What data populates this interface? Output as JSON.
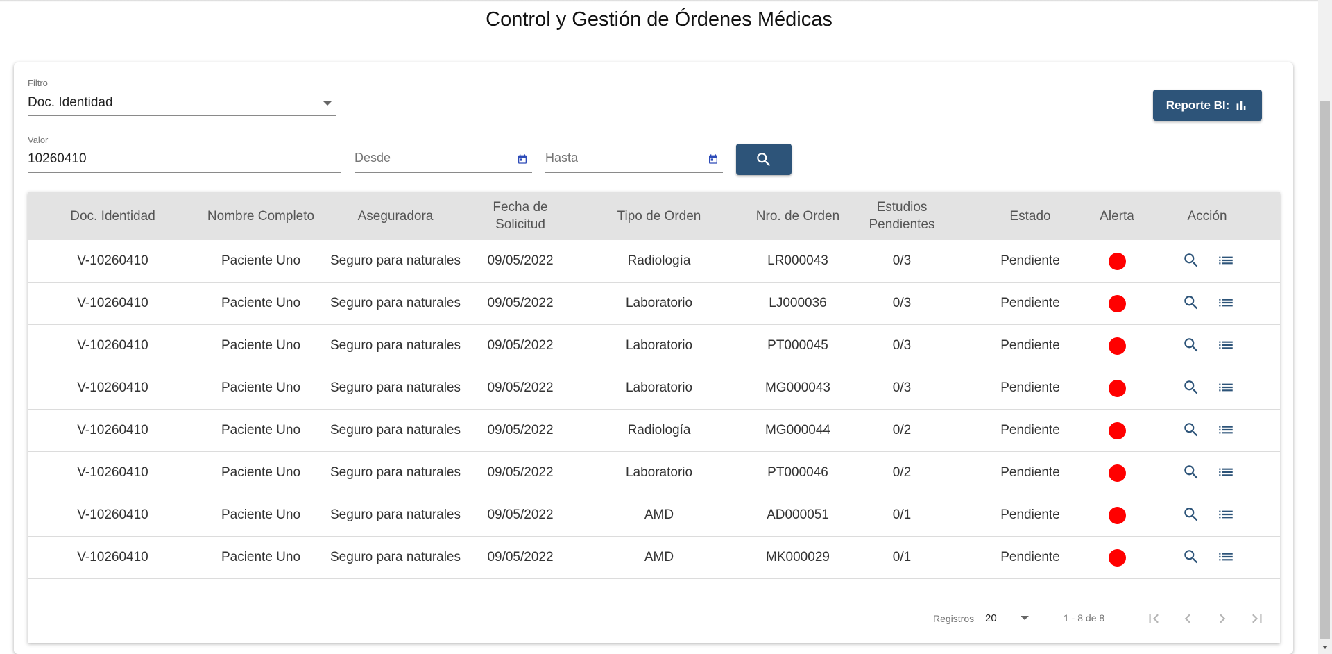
{
  "page": {
    "title": "Control y Gestión de Órdenes Médicas"
  },
  "filters": {
    "filter_label": "Filtro",
    "filter_value": "Doc. Identidad",
    "valor_label": "Valor",
    "valor_value": "10260410",
    "desde_placeholder": "Desde",
    "hasta_placeholder": "Hasta",
    "search_icon": "search-icon",
    "calendar_icon": "calendar-icon"
  },
  "report_button": {
    "label": "Reporte BI:",
    "icon": "bar-chart-icon"
  },
  "table": {
    "headers": {
      "doc": "Doc. Identidad",
      "nombre": "Nombre Completo",
      "aseguradora": "Aseguradora",
      "fecha_1": "Fecha de",
      "fecha_2": "Solicitud",
      "tipo": "Tipo de Orden",
      "nro": "Nro. de Orden",
      "estudios_1": "Estudios",
      "estudios_2": "Pendientes",
      "estado": "Estado",
      "alerta": "Alerta",
      "accion": "Acción"
    },
    "alert_color": "#ff0000",
    "rows": [
      {
        "doc": "V-10260410",
        "nombre": "Paciente Uno",
        "aseguradora": "Seguro para naturales",
        "fecha": "09/05/2022",
        "tipo": "Radiología",
        "nro": "LR000043",
        "estudios": "0/3",
        "estado": "Pendiente"
      },
      {
        "doc": "V-10260410",
        "nombre": "Paciente Uno",
        "aseguradora": "Seguro para naturales",
        "fecha": "09/05/2022",
        "tipo": "Laboratorio",
        "nro": "LJ000036",
        "estudios": "0/3",
        "estado": "Pendiente"
      },
      {
        "doc": "V-10260410",
        "nombre": "Paciente Uno",
        "aseguradora": "Seguro para naturales",
        "fecha": "09/05/2022",
        "tipo": "Laboratorio",
        "nro": "PT000045",
        "estudios": "0/3",
        "estado": "Pendiente"
      },
      {
        "doc": "V-10260410",
        "nombre": "Paciente Uno",
        "aseguradora": "Seguro para naturales",
        "fecha": "09/05/2022",
        "tipo": "Laboratorio",
        "nro": "MG000043",
        "estudios": "0/3",
        "estado": "Pendiente"
      },
      {
        "doc": "V-10260410",
        "nombre": "Paciente Uno",
        "aseguradora": "Seguro para naturales",
        "fecha": "09/05/2022",
        "tipo": "Radiología",
        "nro": "MG000044",
        "estudios": "0/2",
        "estado": "Pendiente"
      },
      {
        "doc": "V-10260410",
        "nombre": "Paciente Uno",
        "aseguradora": "Seguro para naturales",
        "fecha": "09/05/2022",
        "tipo": "Laboratorio",
        "nro": "PT000046",
        "estudios": "0/2",
        "estado": "Pendiente"
      },
      {
        "doc": "V-10260410",
        "nombre": "Paciente Uno",
        "aseguradora": "Seguro para naturales",
        "fecha": "09/05/2022",
        "tipo": "AMD",
        "nro": "AD000051",
        "estudios": "0/1",
        "estado": "Pendiente"
      },
      {
        "doc": "V-10260410",
        "nombre": "Paciente Uno",
        "aseguradora": "Seguro para naturales",
        "fecha": "09/05/2022",
        "tipo": "AMD",
        "nro": "MK000029",
        "estudios": "0/1",
        "estado": "Pendiente"
      }
    ],
    "action_icons": [
      "search-icon",
      "list-icon"
    ]
  },
  "paginator": {
    "label": "Registros",
    "page_size": "20",
    "range": "1 - 8 de 8",
    "icons": [
      "first-page-icon",
      "prev-page-icon",
      "next-page-icon",
      "last-page-icon"
    ]
  },
  "colors": {
    "primary": "#2d5479",
    "header_bg": "#e3e3e3",
    "icon_blue": "#2d5479"
  }
}
